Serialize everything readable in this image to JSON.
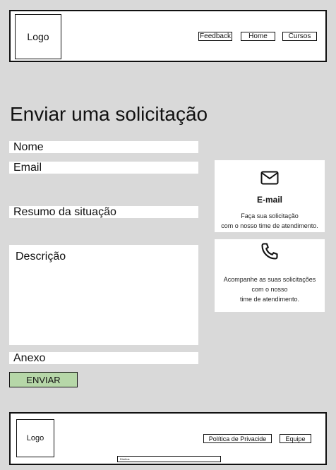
{
  "header": {
    "logo": "Logo",
    "nav": {
      "feedback": "Feedback",
      "home": "Home",
      "cursos": "Cursos"
    }
  },
  "form": {
    "title": "Enviar uma solicitação",
    "nome": "Nome",
    "email": "Email",
    "resumo": "Resumo da situação",
    "descricao": "Descrição",
    "anexo": "Anexo",
    "submit": "ENVIAR"
  },
  "cards": {
    "email": {
      "icon": "mail-icon",
      "heading": "E-mail",
      "text": "Faça sua solicitação\ncom o nosso time de atendimento."
    },
    "phone": {
      "icon": "phone-icon",
      "text": "Acompanhe as suas solicitações\ncom o nosso\ntime de atendimento."
    }
  },
  "footer": {
    "logo": "Logo",
    "privacy": "Política de Privacide",
    "team": "Equipe",
    "rights": "Direitos"
  },
  "colors": {
    "background": "#d9d9d9",
    "submit": "#b6d7a8"
  }
}
